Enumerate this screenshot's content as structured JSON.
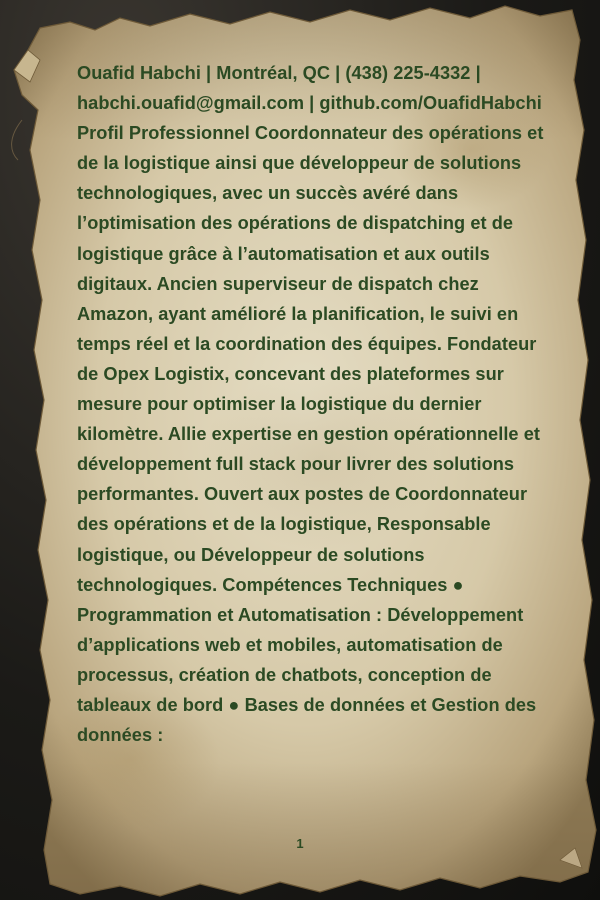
{
  "document": {
    "text": "Ouafid Habchi | Montréal, QC | (438) 225-4332 | habchi.ouafid@gmail.com | github.com/OuafidHabchi Profil Professionnel Coordonnateur des opérations et de la logistique ainsi que développeur de solutions technologiques, avec un succès avéré dans l’optimisation des opérations de dispatching et de logistique grâce à l’automatisation et aux outils digitaux. Ancien superviseur de dispatch chez Amazon, ayant amélioré la planification, le suivi en temps réel et la coordination des équipes. Fondateur de Opex Logistix, concevant des plateformes sur mesure pour optimiser la logistique du dernier kilomètre. Allie expertise en gestion opérationnelle et développement full stack pour livrer des solutions performantes. Ouvert aux postes de Coordonnateur des opérations et de la logistique, Responsable logistique, ou Développeur de solutions technologiques. Compétences Techniques ● Programmation et Automatisation : Développement d’applications web et mobiles, automatisation de processus, création de chatbots, conception de tableaux de bord ● Bases de données et Gestion des données :",
    "page_number": "1"
  },
  "colors": {
    "text": "#2b4a23",
    "parchment": "#d8ccae",
    "background": "#1c1b18"
  }
}
